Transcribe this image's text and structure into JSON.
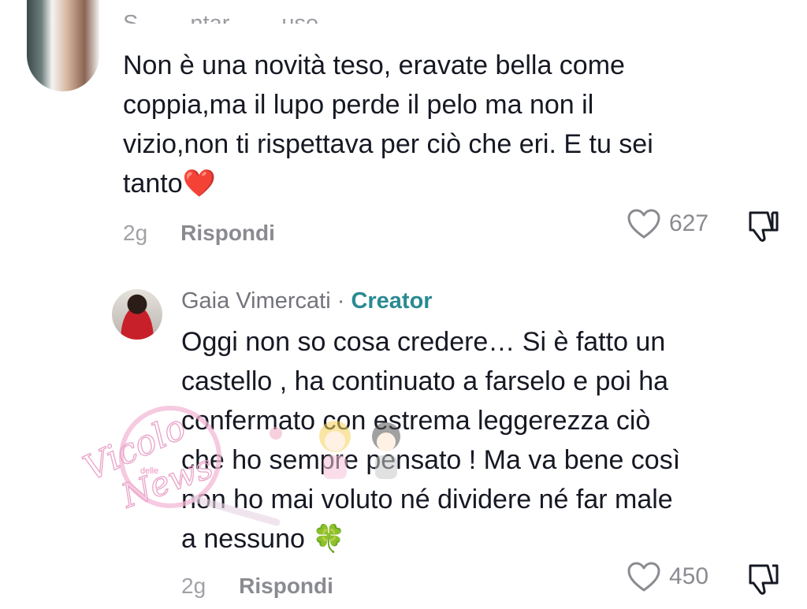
{
  "comments": [
    {
      "username": "S… …ntar… …uso",
      "text_lines": [
        "Non è una novità teso, eravate bella come",
        "coppia,ma il lupo perde il pelo ma non il",
        "vizio,non ti rispettava per ciò che eri. E tu sei",
        "tanto"
      ],
      "emoji_end": "❤️",
      "time": "2g",
      "reply_label": "Rispondi",
      "likes": "627"
    },
    {
      "username": "Gaia Vimercati",
      "separator": " · ",
      "badge": "Creator",
      "text_lines": [
        "Oggi non so cosa credere… Si è fatto un",
        "castello , ha continuato a farselo e poi ha",
        "confermato con estrema leggerezza ciò",
        "che ho sempre pensato ! Ma va bene così",
        "non ho mai voluto né dividere né far male",
        "a nessuno"
      ],
      "emoji_end": "🍀",
      "time": "2g",
      "reply_label": "Rispondi",
      "likes": "450"
    }
  ],
  "watermark": {
    "text_main": "Vicolo",
    "text_small": "delle",
    "text_sub": "News"
  },
  "icons": {
    "like": "heart-outline-icon",
    "dislike": "thumbs-down-icon"
  },
  "colors": {
    "creator_badge": "#2a8a93",
    "heart": "#e0245e"
  }
}
